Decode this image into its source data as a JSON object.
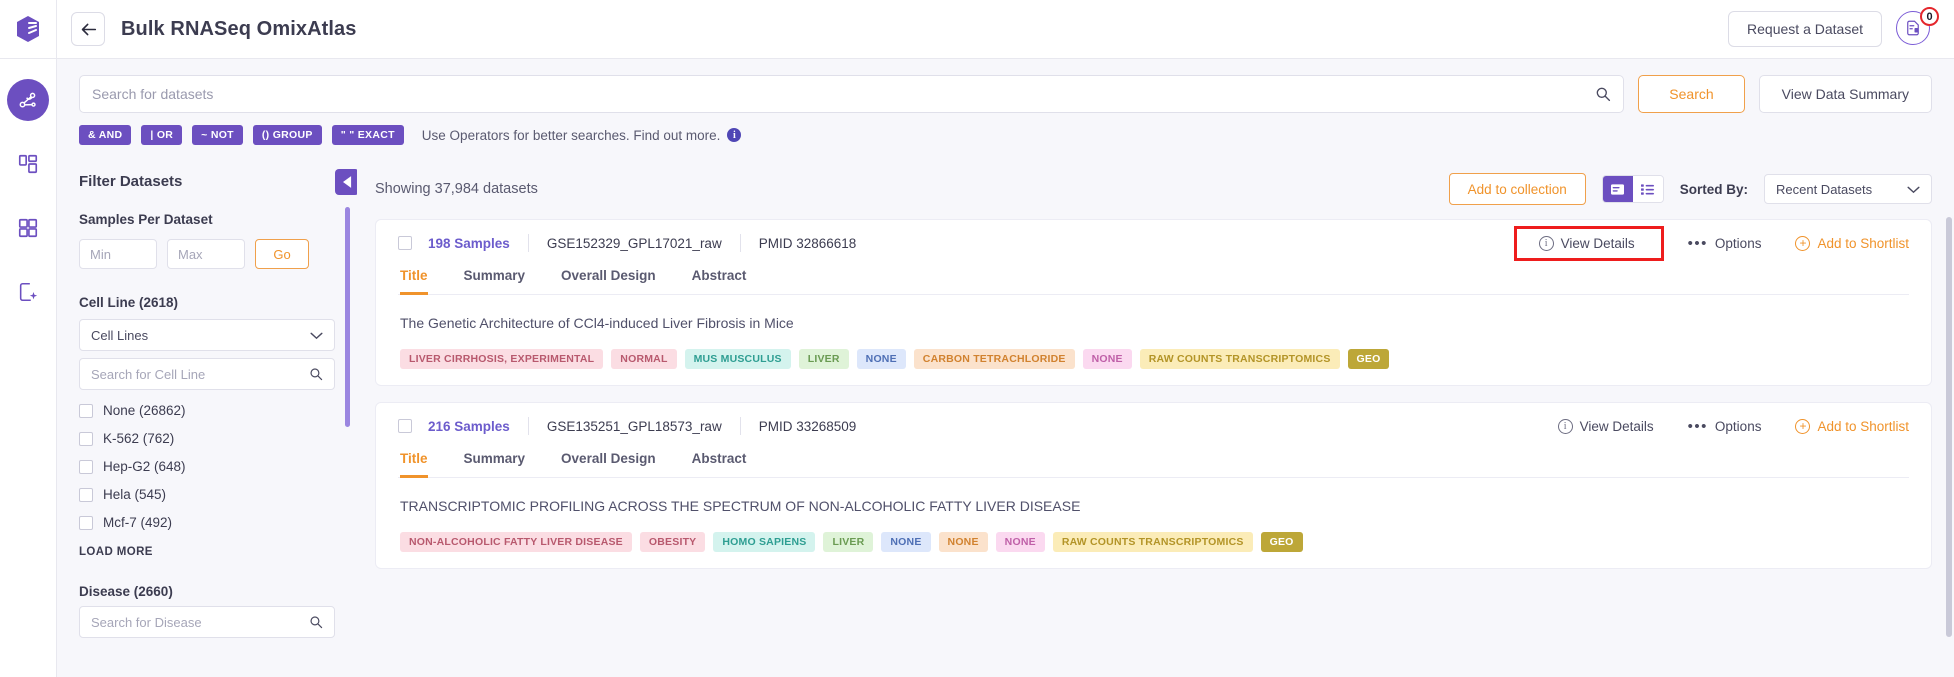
{
  "rail": {
    "logo_icon": "polly-logo-icon",
    "items": [
      {
        "name": "atlas-icon",
        "active": true
      },
      {
        "name": "dashboard-icon",
        "active": false
      },
      {
        "name": "apps-grid-icon",
        "active": false
      },
      {
        "name": "reports-icon",
        "active": false
      }
    ]
  },
  "header": {
    "back_icon": "arrow-left-icon",
    "title": "Bulk RNASeq OmixAtlas",
    "request_dataset_label": "Request a Dataset",
    "shortlist_icon": "shortlist-icon",
    "shortlist_count": "0"
  },
  "search": {
    "placeholder": "Search for datasets",
    "value": "",
    "search_icon": "search-icon",
    "search_button_label": "Search",
    "view_data_summary_label": "View Data Summary",
    "operators": [
      {
        "label": "& AND"
      },
      {
        "label": "| OR"
      },
      {
        "label": "~ NOT"
      },
      {
        "label": "() GROUP"
      },
      {
        "label": "\" \" EXACT"
      }
    ],
    "hint": "Use Operators for better searches. Find out more.",
    "hint_icon": "info-icon"
  },
  "filters": {
    "title": "Filter Datasets",
    "collapse_icon": "chevron-left-icon",
    "samples_per_dataset": {
      "label": "Samples Per Dataset",
      "min_placeholder": "Min",
      "min_value": "",
      "max_placeholder": "Max",
      "max_value": "",
      "go_label": "Go"
    },
    "cell_line": {
      "label": "Cell Line (2618)",
      "select_value": "Cell Lines",
      "select_icon": "chevron-down-icon",
      "search_placeholder": "Search for Cell Line",
      "search_icon": "search-icon",
      "options": [
        {
          "label": "None (26862)",
          "checked": false
        },
        {
          "label": "K-562 (762)",
          "checked": false
        },
        {
          "label": "Hep-G2 (648)",
          "checked": false
        },
        {
          "label": "Hela (545)",
          "checked": false
        },
        {
          "label": "Mcf-7 (492)",
          "checked": false
        }
      ],
      "load_more_label": "LOAD MORE"
    },
    "disease": {
      "label": "Disease (2660)",
      "search_placeholder": "Search for Disease",
      "search_icon": "search-icon"
    }
  },
  "results": {
    "showing": "Showing 37,984 datasets",
    "add_to_collection_label": "Add to collection",
    "view_card_icon": "card-view-icon",
    "view_list_icon": "list-view-icon",
    "sorted_by_label": "Sorted By:",
    "sort_value": "Recent Datasets",
    "sort_icon": "chevron-down-icon",
    "cards": [
      {
        "samples": "198 Samples",
        "gse": "GSE152329_GPL17021_raw",
        "pmid": "PMID 32866618",
        "view_details_label": "View Details",
        "view_details_icon": "info-icon",
        "options_label": "Options",
        "options_icon": "ellipsis-icon",
        "shortlist_label": "Add to Shortlist",
        "shortlist_icon": "plus-circle-icon",
        "highlighted": true,
        "tabs": [
          {
            "label": "Title",
            "active": true
          },
          {
            "label": "Summary",
            "active": false
          },
          {
            "label": "Overall Design",
            "active": false
          },
          {
            "label": "Abstract",
            "active": false
          }
        ],
        "title": "The Genetic Architecture of CCl4-induced Liver Fibrosis in Mice",
        "tags": [
          {
            "label": "LIVER CIRRHOSIS, EXPERIMENTAL",
            "bg": "#fbdde3",
            "fg": "#b8596e"
          },
          {
            "label": "NORMAL",
            "bg": "#fbdde3",
            "fg": "#b8596e"
          },
          {
            "label": "MUS MUSCULUS",
            "bg": "#d4f3ee",
            "fg": "#2e9e92"
          },
          {
            "label": "LIVER",
            "bg": "#dff3d8",
            "fg": "#6a9b52"
          },
          {
            "label": "NONE",
            "bg": "#dde7fb",
            "fg": "#4e6fb5"
          },
          {
            "label": "CARBON TETRACHLORIDE",
            "bg": "#fbe2cc",
            "fg": "#d1822f"
          },
          {
            "label": "NONE",
            "bg": "#fbd9f0",
            "fg": "#bf5fa8"
          },
          {
            "label": "RAW COUNTS TRANSCRIPTOMICS",
            "bg": "#fbecb8",
            "fg": "#b39427"
          },
          {
            "label": "GEO",
            "bg": "#bda738",
            "fg": "#ffffff"
          }
        ]
      },
      {
        "samples": "216 Samples",
        "gse": "GSE135251_GPL18573_raw",
        "pmid": "PMID 33268509",
        "view_details_label": "View Details",
        "view_details_icon": "info-icon",
        "options_label": "Options",
        "options_icon": "ellipsis-icon",
        "shortlist_label": "Add to Shortlist",
        "shortlist_icon": "plus-circle-icon",
        "highlighted": false,
        "tabs": [
          {
            "label": "Title",
            "active": true
          },
          {
            "label": "Summary",
            "active": false
          },
          {
            "label": "Overall Design",
            "active": false
          },
          {
            "label": "Abstract",
            "active": false
          }
        ],
        "title": "TRANSCRIPTOMIC PROFILING ACROSS THE SPECTRUM OF NON-ALCOHOLIC FATTY LIVER DISEASE",
        "tags": [
          {
            "label": "NON-ALCOHOLIC FATTY LIVER DISEASE",
            "bg": "#fbdde3",
            "fg": "#b8596e"
          },
          {
            "label": "OBESITY",
            "bg": "#fbdde3",
            "fg": "#b8596e"
          },
          {
            "label": "HOMO SAPIENS",
            "bg": "#d4f3ee",
            "fg": "#2e9e92"
          },
          {
            "label": "LIVER",
            "bg": "#dff3d8",
            "fg": "#6a9b52"
          },
          {
            "label": "NONE",
            "bg": "#dde7fb",
            "fg": "#4e6fb5"
          },
          {
            "label": "NONE",
            "bg": "#fbe2cc",
            "fg": "#d1822f"
          },
          {
            "label": "NONE",
            "bg": "#fbd9f0",
            "fg": "#bf5fa8"
          },
          {
            "label": "RAW COUNTS TRANSCRIPTOMICS",
            "bg": "#fbecb8",
            "fg": "#b39427"
          },
          {
            "label": "GEO",
            "bg": "#bda738",
            "fg": "#ffffff"
          }
        ]
      }
    ]
  },
  "theme": {
    "purple": "#6c4fc0",
    "orange": "#f0932b",
    "highlight_red": "#ee1d1d",
    "text_dark": "#3c3c50",
    "bg_grey": "#f7f7fb"
  }
}
